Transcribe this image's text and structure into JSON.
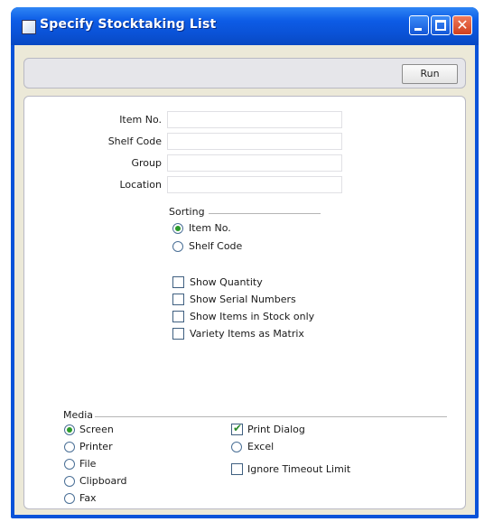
{
  "window": {
    "title": "Specify Stocktaking List"
  },
  "toolbar": {
    "run_label": "Run"
  },
  "fields": [
    {
      "label": "Item No.",
      "value": ""
    },
    {
      "label": "Shelf Code",
      "value": ""
    },
    {
      "label": "Group",
      "value": ""
    },
    {
      "label": "Location",
      "value": ""
    }
  ],
  "sorting": {
    "title": "Sorting",
    "options": [
      {
        "label": "Item No.",
        "selected": true
      },
      {
        "label": "Shelf Code",
        "selected": false
      }
    ]
  },
  "checkboxes": [
    {
      "label": "Show Quantity",
      "checked": false
    },
    {
      "label": "Show Serial Numbers",
      "checked": false
    },
    {
      "label": "Show Items in Stock only",
      "checked": false
    },
    {
      "label": "Variety Items as Matrix",
      "checked": false
    }
  ],
  "media": {
    "title": "Media",
    "options": [
      {
        "label": "Screen",
        "selected": true
      },
      {
        "label": "Printer",
        "selected": false
      },
      {
        "label": "File",
        "selected": false
      },
      {
        "label": "Clipboard",
        "selected": false
      },
      {
        "label": "Fax",
        "selected": false
      }
    ],
    "print_dialog": {
      "label": "Print Dialog",
      "checked": true
    },
    "excel": {
      "label": "Excel",
      "selected": false
    },
    "ignore_timeout": {
      "label": "Ignore Timeout Limit",
      "checked": false
    }
  },
  "colors": {
    "titlebar": "#0a52d6",
    "panel": "#ffffff",
    "frame": "#ece9d8",
    "radio_dot": "#2a9a2a"
  }
}
